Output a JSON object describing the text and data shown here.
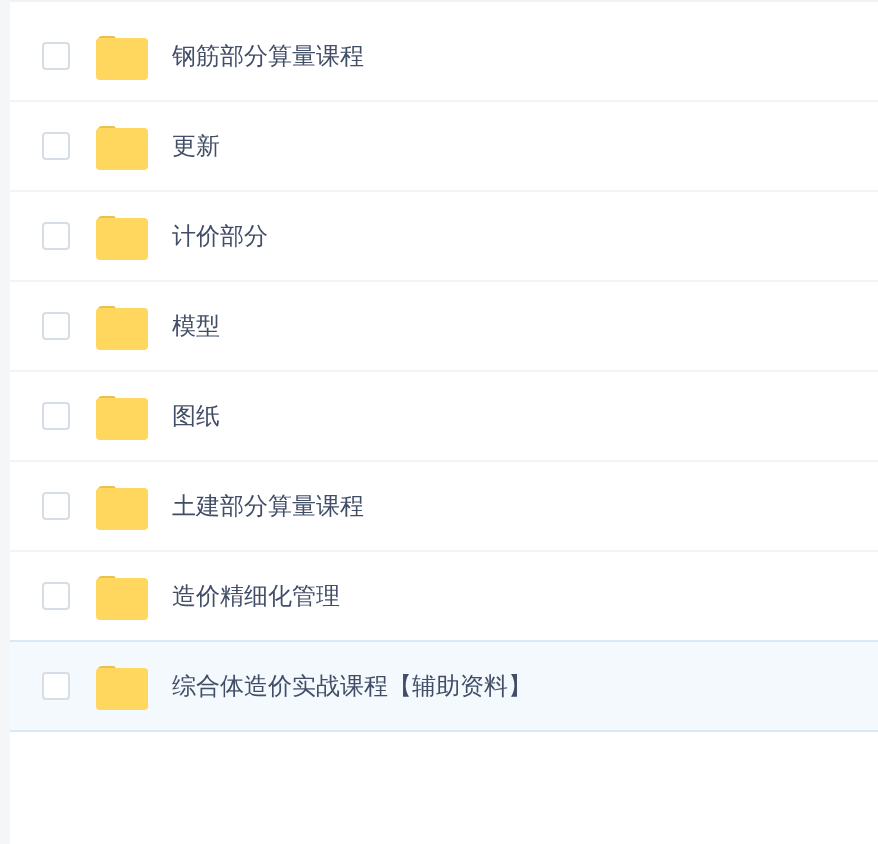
{
  "files": [
    {
      "name": "钢筋部分算量课程",
      "checked": false,
      "highlighted": false
    },
    {
      "name": "更新",
      "checked": false,
      "highlighted": false
    },
    {
      "name": "计价部分",
      "checked": false,
      "highlighted": false
    },
    {
      "name": "模型",
      "checked": false,
      "highlighted": false
    },
    {
      "name": "图纸",
      "checked": false,
      "highlighted": false
    },
    {
      "name": "土建部分算量课程",
      "checked": false,
      "highlighted": false
    },
    {
      "name": "造价精细化管理",
      "checked": false,
      "highlighted": false
    },
    {
      "name": "综合体造价实战课程【辅助资料】",
      "checked": false,
      "highlighted": true
    }
  ]
}
